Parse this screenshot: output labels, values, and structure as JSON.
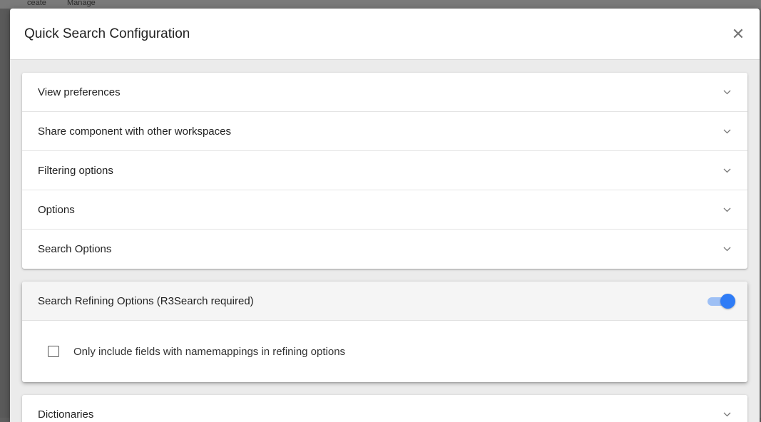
{
  "background": {
    "menu_items": [
      "ceate",
      "Manage"
    ]
  },
  "dialog": {
    "title": "Quick Search Configuration",
    "close_icon": "close-icon"
  },
  "sections": [
    {
      "label": "View preferences",
      "icon": "chevron-down-icon"
    },
    {
      "label": "Share component with other workspaces",
      "icon": "chevron-down-icon"
    },
    {
      "label": "Filtering options",
      "icon": "chevron-down-icon"
    },
    {
      "label": "Options",
      "icon": "chevron-down-icon"
    },
    {
      "label": "Search Options",
      "icon": "chevron-down-icon"
    }
  ],
  "refining": {
    "label": "Search Refining Options (R3Search required)",
    "toggle_on": true,
    "checkbox_label": "Only include fields with namemappings in refining options",
    "checkbox_checked": false
  },
  "dictionaries": {
    "label": "Dictionaries",
    "icon": "chevron-down-icon"
  },
  "colors": {
    "accent": "#2f7cf6",
    "toggle_track": "#9ec0f5"
  }
}
